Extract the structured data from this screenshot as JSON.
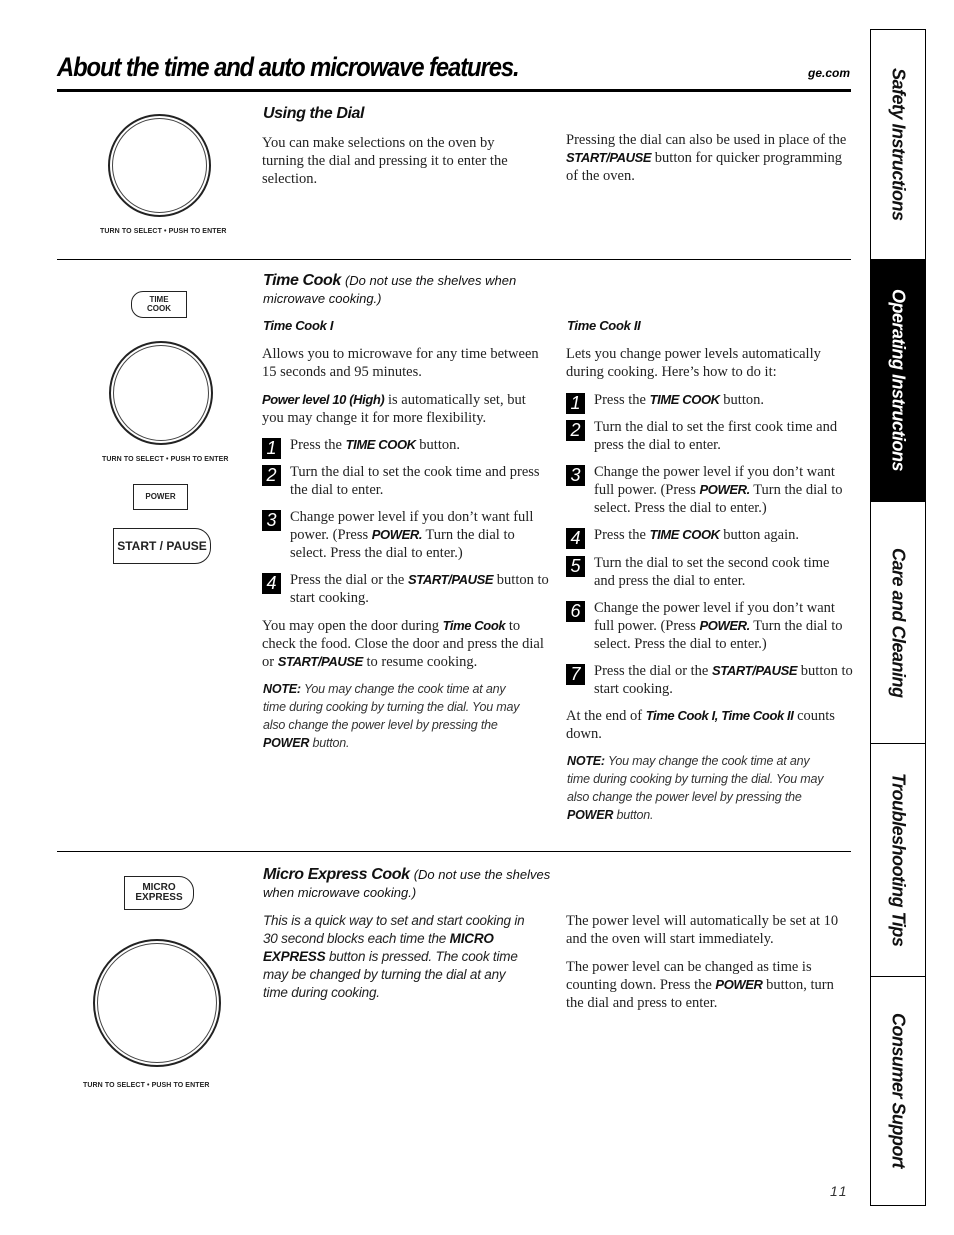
{
  "header": {
    "title": "About the time and auto microwave features.",
    "site": "ge.com"
  },
  "tabs": [
    {
      "label": "Safety Instructions",
      "active": false
    },
    {
      "label": "Operating Instructions",
      "active": true
    },
    {
      "label": "Care and Cleaning",
      "active": false
    },
    {
      "label": "Troubleshooting Tips",
      "active": false
    },
    {
      "label": "Consumer Support",
      "active": false
    }
  ],
  "dial_label": "TURN TO SELECT  •  PUSH TO ENTER",
  "using_dial": {
    "heading": "Using the Dial",
    "left": "You can make selections on the oven by turning the dial and pressing it to enter the selection.",
    "right_pre": "Pressing the dial can also be used in place of the ",
    "right_bold": "START/PAUSE",
    "right_post": " button for quicker programming of the oven."
  },
  "time_cook": {
    "heading": "Time Cook",
    "heading_note": "(Do not use the shelves when microwave cooking.)",
    "buttons": {
      "time_cook_line1": "TIME",
      "time_cook_line2": "COOK",
      "power": "POWER",
      "start_pause": "START / PAUSE"
    },
    "tc1": {
      "heading": "Time Cook I",
      "intro": "Allows you to microwave for any time between 15 seconds and 95 minutes.",
      "power_bold": "Power level 10 (High)",
      "power_rest": " is automatically set, but you may change it for more flexibility.",
      "steps": [
        {
          "n": "1",
          "pre": "Press the ",
          "bold": "TIME COOK",
          "post": " button."
        },
        {
          "n": "2",
          "pre": "Turn the dial to set the cook time and press the dial to enter.",
          "bold": "",
          "post": ""
        },
        {
          "n": "3",
          "pre": "Change power level if you don’t want full power. (Press ",
          "bold": "POWER.",
          "post": " Turn the dial to select. Press the dial to enter.)"
        },
        {
          "n": "4",
          "pre": "Press the dial or the ",
          "bold": "START/PAUSE",
          "post": " button to start cooking."
        }
      ],
      "door_pre": "You may open the door during ",
      "door_bold1": "Time Cook",
      "door_mid": " to check the food. Close the door and press the dial or ",
      "door_bold2": "START/PAUSE",
      "door_post": " to resume cooking.",
      "note_label": "NOTE:",
      "note_text": " You may change the cook time at any time during cooking by turning the dial. You may also change the power level by pressing the ",
      "note_bold": "POWER",
      "note_end": " button."
    },
    "tc2": {
      "heading": "Time Cook II",
      "intro": "Lets you change power levels automatically during cooking. Here’s how to do it:",
      "steps": [
        {
          "n": "1",
          "pre": "Press the ",
          "bold": "TIME COOK",
          "post": " button."
        },
        {
          "n": "2",
          "pre": "Turn the dial to set the first cook time and press the dial to enter.",
          "bold": "",
          "post": ""
        },
        {
          "n": "3",
          "pre": "Change the power level if you don’t want full power. (Press ",
          "bold": "POWER.",
          "post": " Turn the dial to select. Press the dial to enter.)"
        },
        {
          "n": "4",
          "pre": "Press the ",
          "bold": "TIME COOK",
          "post": " button again."
        },
        {
          "n": "5",
          "pre": "Turn the dial to set the second cook time and press the dial to enter.",
          "bold": "",
          "post": ""
        },
        {
          "n": "6",
          "pre": "Change the power level if you don’t want full power. (Press ",
          "bold": "POWER.",
          "post": " Turn the dial to select. Press the dial to enter.)"
        },
        {
          "n": "7",
          "pre": "Press the dial or the ",
          "bold": "START/PAUSE",
          "post": " button to start cooking."
        }
      ],
      "end_pre": "At the end of ",
      "end_bold": "Time Cook I, Time Cook II",
      "end_post": " counts down.",
      "note_label": "NOTE:",
      "note_text": " You may change the cook time at any time during cooking by turning the dial. You may also change the power level by pressing the ",
      "note_bold": "POWER",
      "note_end": " button."
    }
  },
  "micro_express": {
    "heading": "Micro Express Cook",
    "heading_note": "(Do not use the shelves when microwave cooking.)",
    "button_line1": "MICRO",
    "button_line2": "EXPRESS",
    "desc_pre": "This is a quick way to set and start cooking in 30 second blocks each time the ",
    "desc_bold": "MICRO EXPRESS",
    "desc_post": " button is pressed. The cook time may be changed by turning the dial at any time during cooking.",
    "right1": "The power level will automatically be set at 10 and the oven will start immediately.",
    "right2_pre": "The power level can be changed as time is counting down. Press the ",
    "right2_bold": "POWER",
    "right2_post": " button, turn the dial and press to enter."
  },
  "page_number": "11"
}
